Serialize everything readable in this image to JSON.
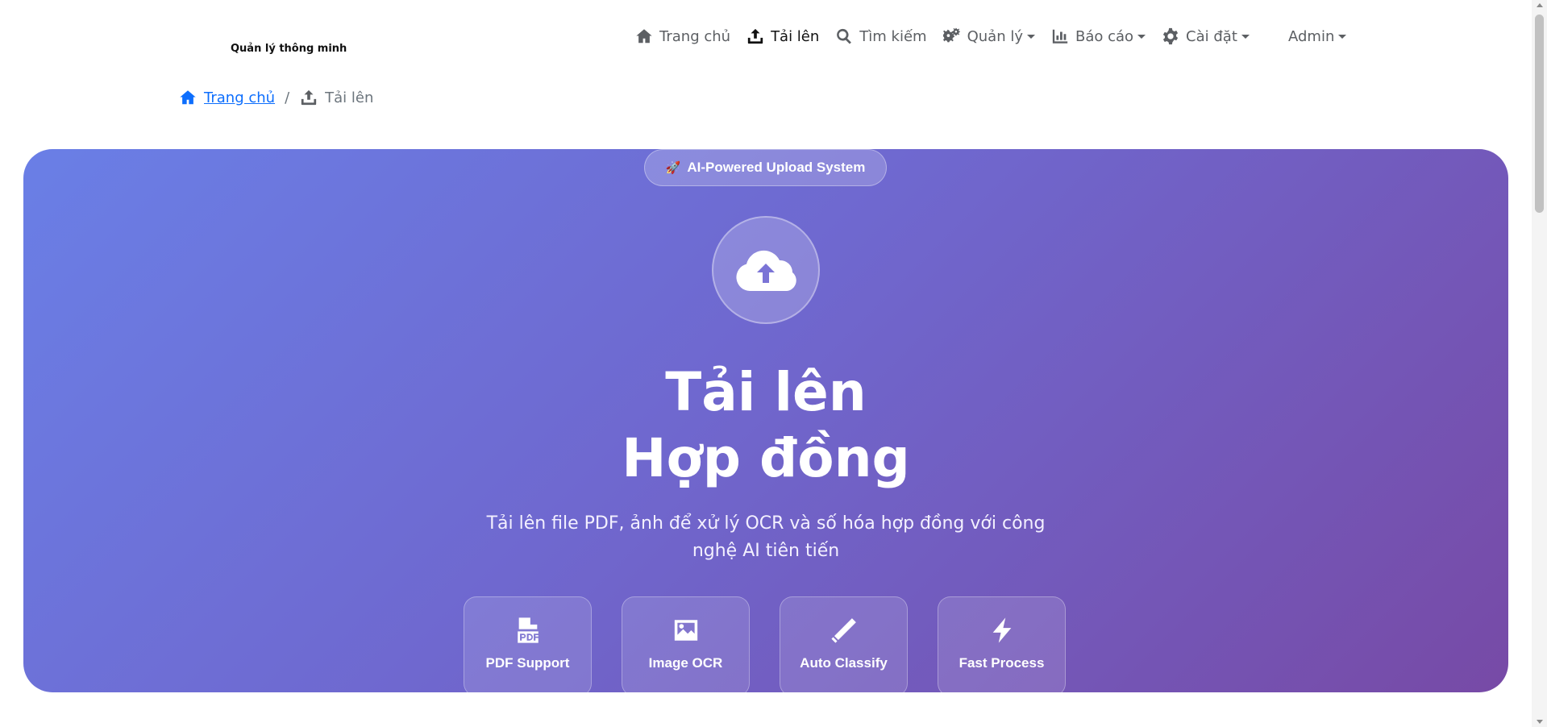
{
  "brand": {
    "name": "Quản lý thông minh"
  },
  "nav": {
    "items": [
      {
        "label": "Trang chủ",
        "icon": "home-icon"
      },
      {
        "label": "Tải lên",
        "icon": "upload-icon",
        "active": true
      },
      {
        "label": "Tìm kiếm",
        "icon": "search-icon"
      },
      {
        "label": "Quản lý",
        "icon": "gears-icon",
        "dropdown": true
      },
      {
        "label": "Báo cáo",
        "icon": "chart-icon",
        "dropdown": true
      },
      {
        "label": "Cài đặt",
        "icon": "gear-icon",
        "dropdown": true
      }
    ],
    "user": "Admin"
  },
  "breadcrumb": {
    "home": "Trang chủ",
    "separator": "/",
    "current": "Tải lên"
  },
  "hero": {
    "badge": "AI-Powered Upload System",
    "badge_icon": "rocket-icon",
    "main_icon": "cloud-upload-icon",
    "title_line1": "Tải lên",
    "title_line2": "Hợp đồng",
    "subtitle": "Tải lên file PDF, ảnh để xử lý OCR và số hóa hợp đồng với công nghệ AI tiên tiến",
    "features": [
      {
        "label": "PDF Support",
        "icon": "file-pdf-icon"
      },
      {
        "label": "Image OCR",
        "icon": "image-icon"
      },
      {
        "label": "Auto Classify",
        "icon": "magic-wand-icon"
      },
      {
        "label": "Fast Process",
        "icon": "bolt-icon"
      }
    ]
  },
  "colors": {
    "gradient_start": "#6a7fe6",
    "gradient_end": "#774aa6",
    "link": "#0d6efd"
  }
}
